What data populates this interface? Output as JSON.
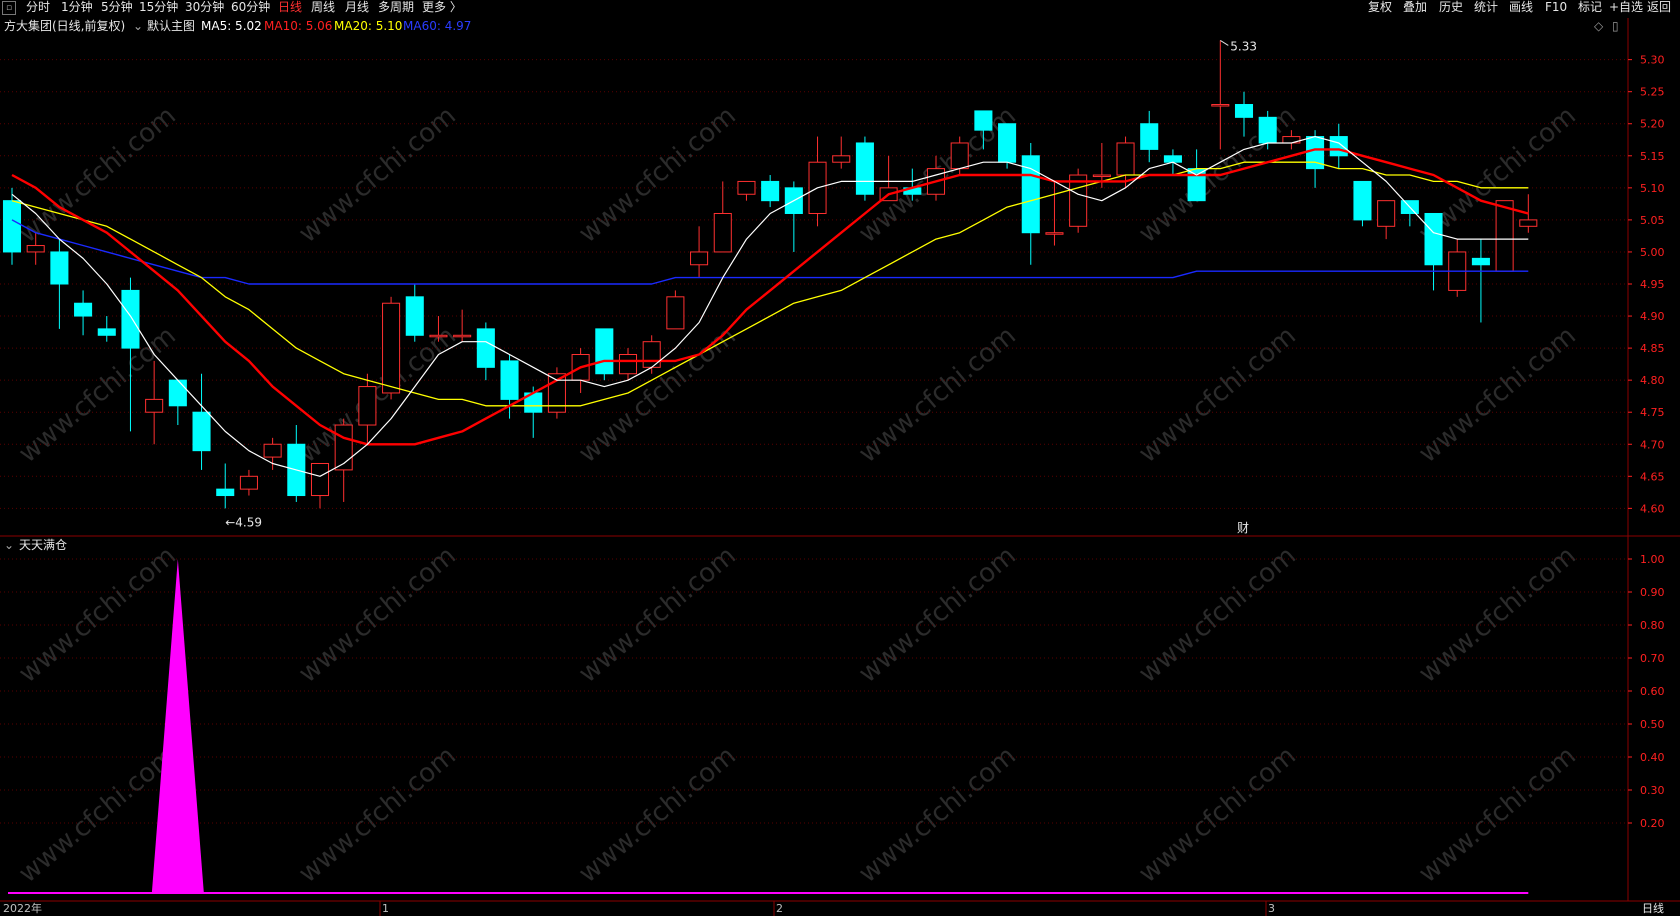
{
  "toolbar": {
    "periods": [
      "分时",
      "1分钟",
      "5分钟",
      "15分钟",
      "30分钟",
      "60分钟",
      "日线",
      "周线",
      "月线",
      "多周期",
      "更多 〉"
    ],
    "active": "日线",
    "right": [
      "复权",
      "叠加",
      "历史",
      "统计",
      "画线",
      "F10",
      "标记",
      "+自选",
      "返回"
    ]
  },
  "legend": {
    "stock": "方大集团(日线,前复权)",
    "main": "默认主图",
    "ma5": "MA5: 5.02",
    "ma10": "MA10: 5.06",
    "ma20": "MA20: 5.10",
    "ma60": "MA60: 4.97"
  },
  "colors": {
    "up": "#ff3030",
    "down": "#00ffff",
    "ma5": "#ffffff",
    "ma10": "#ff0000",
    "ma20": "#ffff00",
    "ma60": "#1a2aff",
    "indicator": "#ff00ff"
  },
  "annotations": {
    "high": "5.33",
    "low": "4.59",
    "event": "财"
  },
  "price_axis": [
    "5.30",
    "5.25",
    "5.20",
    "5.15",
    "5.10",
    "5.05",
    "5.00",
    "4.95",
    "4.90",
    "4.85",
    "4.80",
    "4.75",
    "4.70",
    "4.65",
    "4.60"
  ],
  "indicator": {
    "name": "天天满仓",
    "axis": [
      "1.00",
      "0.90",
      "0.80",
      "0.70",
      "0.60",
      "0.50",
      "0.40",
      "0.30",
      "0.20"
    ]
  },
  "dates": {
    "year": "2022年",
    "m1": "1",
    "m2": "2",
    "m3": "3",
    "period_label": "日线"
  },
  "watermark": "www.cfchi.com",
  "chart_data": {
    "type": "candlestick",
    "ylim": [
      4.56,
      5.34
    ],
    "candles": [
      [
        5.08,
        5.0,
        5.1,
        4.98
      ],
      [
        5.0,
        5.01,
        5.03,
        4.98
      ],
      [
        5.0,
        4.95,
        5.02,
        4.88
      ],
      [
        4.92,
        4.9,
        4.94,
        4.87
      ],
      [
        4.88,
        4.87,
        4.9,
        4.86
      ],
      [
        4.94,
        4.85,
        4.96,
        4.72
      ],
      [
        4.75,
        4.77,
        4.83,
        4.7
      ],
      [
        4.8,
        4.76,
        4.8,
        4.73
      ],
      [
        4.75,
        4.69,
        4.81,
        4.66
      ],
      [
        4.63,
        4.62,
        4.67,
        4.6
      ],
      [
        4.63,
        4.65,
        4.66,
        4.62
      ],
      [
        4.68,
        4.7,
        4.71,
        4.66
      ],
      [
        4.7,
        4.62,
        4.73,
        4.61
      ],
      [
        4.62,
        4.67,
        4.67,
        4.6
      ],
      [
        4.66,
        4.73,
        4.74,
        4.61
      ],
      [
        4.73,
        4.79,
        4.81,
        4.7
      ],
      [
        4.78,
        4.92,
        4.93,
        4.77
      ],
      [
        4.93,
        4.87,
        4.95,
        4.86
      ],
      [
        4.87,
        4.87,
        4.9,
        4.86
      ],
      [
        4.87,
        4.87,
        4.91,
        4.86
      ],
      [
        4.88,
        4.82,
        4.89,
        4.8
      ],
      [
        4.83,
        4.77,
        4.84,
        4.74
      ],
      [
        4.78,
        4.75,
        4.79,
        4.71
      ],
      [
        4.75,
        4.81,
        4.82,
        4.74
      ],
      [
        4.8,
        4.84,
        4.85,
        4.78
      ],
      [
        4.88,
        4.81,
        4.88,
        4.8
      ],
      [
        4.81,
        4.84,
        4.85,
        4.8
      ],
      [
        4.82,
        4.86,
        4.87,
        4.81
      ],
      [
        4.88,
        4.93,
        4.94,
        4.88
      ],
      [
        4.98,
        5.0,
        5.04,
        4.96
      ],
      [
        5.0,
        5.06,
        5.11,
        5.0
      ],
      [
        5.09,
        5.11,
        5.11,
        5.08
      ],
      [
        5.11,
        5.08,
        5.12,
        5.07
      ],
      [
        5.1,
        5.06,
        5.11,
        5.0
      ],
      [
        5.06,
        5.14,
        5.18,
        5.04
      ],
      [
        5.14,
        5.15,
        5.18,
        5.13
      ],
      [
        5.17,
        5.09,
        5.18,
        5.08
      ],
      [
        5.08,
        5.1,
        5.15,
        5.08
      ],
      [
        5.1,
        5.09,
        5.13,
        5.08
      ],
      [
        5.09,
        5.13,
        5.15,
        5.08
      ],
      [
        5.13,
        5.17,
        5.18,
        5.12
      ],
      [
        5.22,
        5.19,
        5.22,
        5.16
      ],
      [
        5.2,
        5.14,
        5.2,
        5.13
      ],
      [
        5.15,
        5.03,
        5.17,
        4.98
      ],
      [
        5.03,
        5.03,
        5.11,
        5.01
      ],
      [
        5.04,
        5.12,
        5.13,
        5.03
      ],
      [
        5.12,
        5.12,
        5.17,
        5.1
      ],
      [
        5.12,
        5.17,
        5.18,
        5.1
      ],
      [
        5.2,
        5.16,
        5.22,
        5.14
      ],
      [
        5.15,
        5.14,
        5.16,
        5.12
      ],
      [
        5.13,
        5.08,
        5.16,
        5.08
      ],
      [
        5.23,
        5.23,
        5.33,
        5.16
      ],
      [
        5.23,
        5.21,
        5.25,
        5.18
      ],
      [
        5.21,
        5.17,
        5.22,
        5.16
      ],
      [
        5.17,
        5.18,
        5.19,
        5.16
      ],
      [
        5.18,
        5.13,
        5.19,
        5.1
      ],
      [
        5.18,
        5.15,
        5.2,
        5.13
      ],
      [
        5.11,
        5.05,
        5.11,
        5.04
      ],
      [
        5.04,
        5.08,
        5.08,
        5.02
      ],
      [
        5.08,
        5.06,
        5.08,
        5.04
      ],
      [
        5.06,
        4.98,
        5.06,
        4.94
      ],
      [
        4.94,
        5.0,
        5.02,
        4.93
      ],
      [
        4.99,
        4.98,
        5.02,
        4.89
      ],
      [
        4.97,
        5.08,
        5.08,
        4.97
      ],
      [
        5.04,
        5.05,
        5.09,
        5.03
      ]
    ],
    "ma5": [
      5.09,
      5.06,
      5.02,
      4.99,
      4.95,
      4.9,
      4.84,
      4.8,
      4.76,
      4.72,
      4.69,
      4.67,
      4.66,
      4.65,
      4.67,
      4.7,
      4.74,
      4.79,
      4.84,
      4.86,
      4.86,
      4.84,
      4.82,
      4.8,
      4.8,
      4.79,
      4.8,
      4.82,
      4.85,
      4.89,
      4.96,
      5.02,
      5.06,
      5.08,
      5.1,
      5.11,
      5.11,
      5.11,
      5.11,
      5.12,
      5.13,
      5.14,
      5.14,
      5.13,
      5.11,
      5.09,
      5.08,
      5.1,
      5.13,
      5.14,
      5.12,
      5.14,
      5.16,
      5.17,
      5.17,
      5.18,
      5.17,
      5.14,
      5.11,
      5.07,
      5.03,
      5.02,
      5.02,
      5.02,
      5.02
    ],
    "ma10": [
      5.12,
      5.1,
      5.07,
      5.05,
      5.03,
      5.0,
      4.97,
      4.94,
      4.9,
      4.86,
      4.83,
      4.79,
      4.76,
      4.73,
      4.71,
      4.7,
      4.7,
      4.7,
      4.71,
      4.72,
      4.74,
      4.76,
      4.78,
      4.8,
      4.82,
      4.83,
      4.83,
      4.83,
      4.83,
      4.84,
      4.87,
      4.91,
      4.94,
      4.97,
      5.0,
      5.03,
      5.06,
      5.09,
      5.1,
      5.11,
      5.12,
      5.12,
      5.12,
      5.12,
      5.11,
      5.11,
      5.11,
      5.11,
      5.12,
      5.12,
      5.12,
      5.12,
      5.13,
      5.14,
      5.15,
      5.16,
      5.16,
      5.15,
      5.14,
      5.13,
      5.12,
      5.1,
      5.08,
      5.07,
      5.06
    ],
    "ma20": [
      5.08,
      5.07,
      5.06,
      5.05,
      5.04,
      5.02,
      5.0,
      4.98,
      4.96,
      4.93,
      4.91,
      4.88,
      4.85,
      4.83,
      4.81,
      4.8,
      4.79,
      4.78,
      4.77,
      4.77,
      4.76,
      4.76,
      4.76,
      4.76,
      4.76,
      4.77,
      4.78,
      4.8,
      4.82,
      4.84,
      4.86,
      4.88,
      4.9,
      4.92,
      4.93,
      4.94,
      4.96,
      4.98,
      5.0,
      5.02,
      5.03,
      5.05,
      5.07,
      5.08,
      5.09,
      5.1,
      5.11,
      5.12,
      5.12,
      5.12,
      5.13,
      5.13,
      5.14,
      5.14,
      5.14,
      5.14,
      5.13,
      5.13,
      5.12,
      5.12,
      5.11,
      5.11,
      5.1,
      5.1,
      5.1
    ],
    "ma60": [
      5.05,
      5.03,
      5.02,
      5.01,
      5.0,
      4.99,
      4.98,
      4.97,
      4.96,
      4.96,
      4.95,
      4.95,
      4.95,
      4.95,
      4.95,
      4.95,
      4.95,
      4.95,
      4.95,
      4.95,
      4.95,
      4.95,
      4.95,
      4.95,
      4.95,
      4.95,
      4.95,
      4.95,
      4.96,
      4.96,
      4.96,
      4.96,
      4.96,
      4.96,
      4.96,
      4.96,
      4.96,
      4.96,
      4.96,
      4.96,
      4.96,
      4.96,
      4.96,
      4.96,
      4.96,
      4.96,
      4.96,
      4.96,
      4.96,
      4.96,
      4.97,
      4.97,
      4.97,
      4.97,
      4.97,
      4.97,
      4.97,
      4.97,
      4.97,
      4.97,
      4.97,
      4.97,
      4.97,
      4.97,
      4.97
    ],
    "indicator_values": [
      0,
      0,
      0,
      0,
      0,
      0,
      0,
      1,
      0,
      0,
      0,
      0,
      0,
      0,
      0,
      0,
      0,
      0,
      0,
      0,
      0,
      0,
      0,
      0,
      0,
      0,
      0,
      0,
      0,
      0,
      0,
      0,
      0,
      0,
      0,
      0,
      0,
      0,
      0,
      0,
      0,
      0,
      0,
      0,
      0,
      0,
      0,
      0,
      0,
      0,
      0,
      0,
      0,
      0,
      0,
      0,
      0,
      0,
      0,
      0,
      0,
      0,
      0,
      0,
      0
    ]
  }
}
